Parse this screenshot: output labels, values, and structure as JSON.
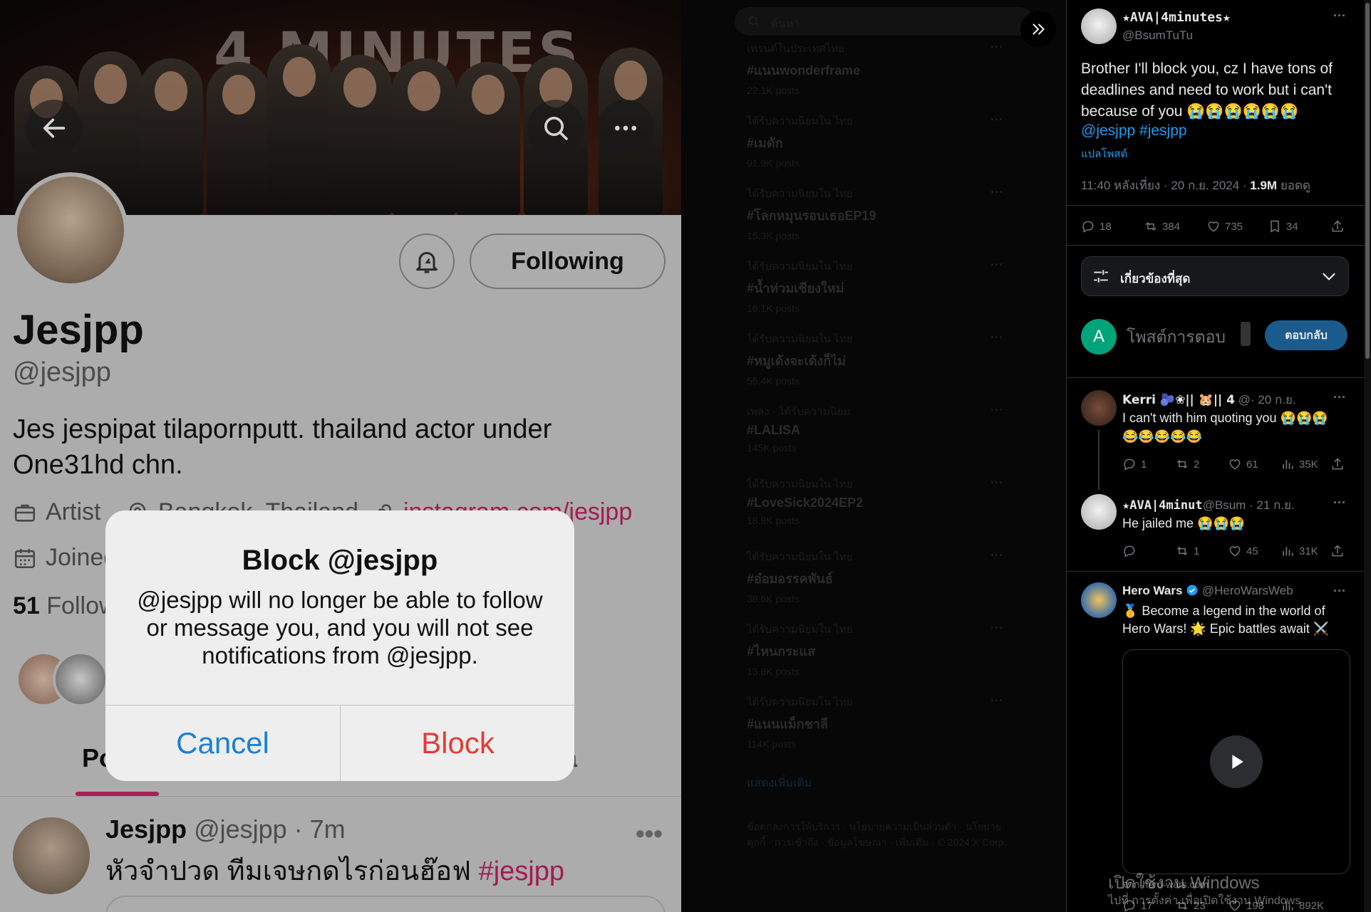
{
  "profile": {
    "banner_title": "4 MINUTES",
    "name": "Jesjpp",
    "handle": "@jesjpp",
    "bio": "Jes jespipat tilapornputt. thailand actor under One31hd chn.",
    "occupation": "Artist",
    "location": "Bangkok, Thailand",
    "link": "instagram.com/jesjpp",
    "joined": "Joined",
    "following_count": "51",
    "following_label": "Follow",
    "following_button": "Following",
    "tabs": {
      "posts": "Po",
      "media": "ia"
    }
  },
  "post": {
    "name": "Jesjpp",
    "handle_time": "@jesjpp · 7m",
    "text": "หัวจำปวด ทีมเจษกดไรก่อนฮ๊อฟ ",
    "hashtag": "#jesjpp",
    "more": "•••"
  },
  "dialog": {
    "title": "Block @jesjpp",
    "message": "@jesjpp will no longer be able to follow or message you, and you will not see notifications from @jesjpp.",
    "cancel": "Cancel",
    "block": "Block"
  },
  "middle": {
    "search_placeholder": "ค้นหา",
    "trends": [
      {
        "category": "เทรนด์ในประเทศไทย",
        "tag": "#แนนwonderframe",
        "count": "22.1K posts"
      },
      {
        "category": "ได้รับความนิยมใน ไทย",
        "tag": "#เมดัก",
        "count": "91.9K posts"
      },
      {
        "category": "ได้รับความนิยมใน ไทย",
        "tag": "#โลกหมุนรอบเธอEP19",
        "count": "15.3K posts"
      },
      {
        "category": "ได้รับความนิยมใน ไทย",
        "tag": "#น้ำท่วมเชียงใหม่",
        "count": "16.1K posts"
      },
      {
        "category": "ได้รับความนิยมใน ไทย",
        "tag": "#หมูเด้งจะเด้งก็ไม่",
        "count": "55.4K posts"
      },
      {
        "category": "เพลง · ได้รับความนิยม",
        "tag": "#LALISA",
        "count": "145K posts"
      },
      {
        "category": "ได้รับความนิยมใน ไทย",
        "tag": "#LoveSick2024EP2",
        "count": "18.9K posts"
      },
      {
        "category": "ได้รับความนิยมใน ไทย",
        "tag": "#อ๋อมอรรคพันธ์",
        "count": "38.6K posts"
      },
      {
        "category": "ได้รับความนิยมใน ไทย",
        "tag": "#ไหนกระแส",
        "count": "13.6K posts"
      },
      {
        "category": "ได้รับความนิยมใน ไทย",
        "tag": "#แนนแม็กชาลี",
        "count": "114K posts"
      }
    ],
    "show_more": "แสดงเพิ่มเติม",
    "footer": "ข้อตกลงการให้บริการ · นโยบายความเป็นส่วนตัว · นโยบายคุกกี้ · การเข้าถึง · ข้อมูลโฆษณา · เพิ่มเติม · © 2024 X Corp."
  },
  "tweet": {
    "author": "★AVA|4minutes★",
    "handle": "@BsumTuTu",
    "text": "Brother I'll block you, cz I have tons of deadlines and need to work but i can't because of you 😭😭😭😭😭😭",
    "mentions": "@jesjpp #jesjpp",
    "translate": "แปลโพสต์",
    "time": "11:40 หลังเที่ยง · 20 ก.ย. 2024 · ",
    "views": "1.9M",
    "views_label": " ยอดดู",
    "replies": "18",
    "reposts": "384",
    "likes": "735",
    "bookmarks": "34",
    "sort_label": "เกี่ยวข้องที่สุด",
    "reply_placeholder": "โพสต์การตอบ",
    "reply_button": "ตอบกลับ",
    "user_initial": "A"
  },
  "replies": [
    {
      "name": "Kerri 🫐❀|| 🐹|| 4",
      "meta": "@· 20 ก.ย.",
      "text": "I can't with him quoting you 😭😭😭😂😂😂😂😂",
      "replies": "1",
      "reposts": "2",
      "likes": "61",
      "views": "35K"
    },
    {
      "name": "★AVA|4minut",
      "meta": "@Bsum · 21 ก.ย.",
      "text": "He jailed me 😭😭😭",
      "replies": "",
      "reposts": "1",
      "likes": "45",
      "views": "31K"
    }
  ],
  "ad": {
    "name": "Hero Wars",
    "handle": "@HeroWarsWeb",
    "text": "🥇 Become a legend in the world of Hero Wars! 🌟 Epic battles await ⚔️",
    "domain": "จาก hero-wars.com",
    "replies": "17",
    "reposts": "23",
    "likes": "198",
    "views": "892K"
  },
  "watermark": {
    "title": "เปิดใช้งาน Windows",
    "subtitle": "ไปที่ การตั้งค่า เพื่อเปิดใช้งาน Windows"
  }
}
